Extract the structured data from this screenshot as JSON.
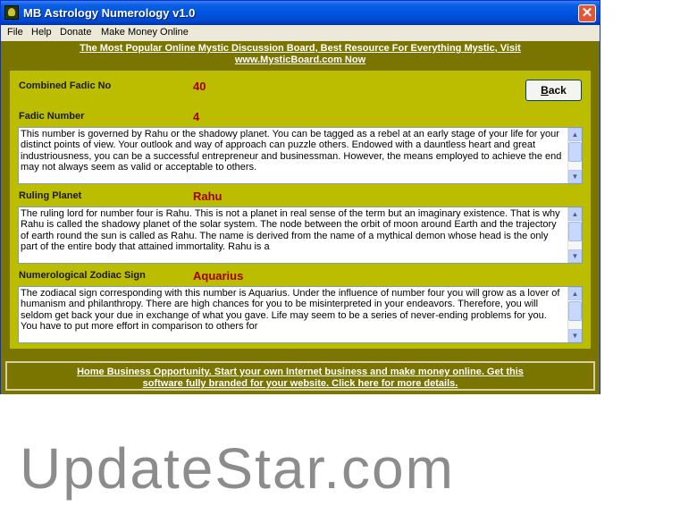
{
  "window": {
    "title": "MB Astrology Numerology v1.0",
    "close_glyph": "✕",
    "icon": "app-icon"
  },
  "menu": [
    {
      "label": "File"
    },
    {
      "label": "Help"
    },
    {
      "label": "Donate"
    },
    {
      "label": "Make Money Online"
    }
  ],
  "top_banner": {
    "line1": "The Most Popular Online Mystic Discussion Board, Best Resource For Everything Mystic, Visit",
    "line2": "www.MysticBoard.com Now"
  },
  "fields": {
    "combined_fadic": {
      "label": "Combined Fadic No",
      "value": "40"
    },
    "fadic_number": {
      "label": "Fadic Number",
      "value": "4",
      "text": "This number is governed by Rahu or the shadowy planet. You can be tagged as a rebel at an early stage of your life for your distinct points of view. Your outlook and way of approach can puzzle others. Endowed with a dauntless heart and great industriousness, you can be a successful entrepreneur and businessman. However, the means employed to achieve the end may not always seem as valid or acceptable to others."
    },
    "ruling_planet": {
      "label": "Ruling Planet",
      "value": "Rahu",
      "text": "The ruling lord for number four is Rahu. This is not a planet in real sense of the term but an imaginary existence. That is why Rahu is called the shadowy planet of the solar system. The node between the orbit of moon around Earth and the trajectory of earth round the sun is called as Rahu. The name is derived from the name of a mythical demon whose head is the only part of the entire body that attained immortality. Rahu is a"
    },
    "zodiac_sign": {
      "label": "Numerological Zodiac Sign",
      "value": "Aquarius",
      "text": "The zodiacal sign corresponding with this number is Aquarius. Under the influence of number four you will grow as a lover of humanism and philanthropy. There are high chances for you to be misinterpreted in your endeavors. Therefore, you will seldom get back your due in exchange of what you gave. Life may seem to be a series of never-ending problems for you. You have to put more effort in comparison to others for"
    }
  },
  "back_button": {
    "label_accel": "B",
    "label_rest": "ack"
  },
  "scrollbar": {
    "up_glyph": "▲",
    "down_glyph": "▼"
  },
  "bottom_banner": {
    "line1": "Home Business Opportunity. Start your own Internet business and make money online. Get this",
    "line2": "software fully branded for your website. Click here for more details."
  },
  "watermark": "UpdateStar.com",
  "colors": {
    "titlebar_blue": "#0054e3",
    "client_olive": "#7a7400",
    "panel_yellow": "#bdbd00",
    "value_red": "#a00000"
  }
}
